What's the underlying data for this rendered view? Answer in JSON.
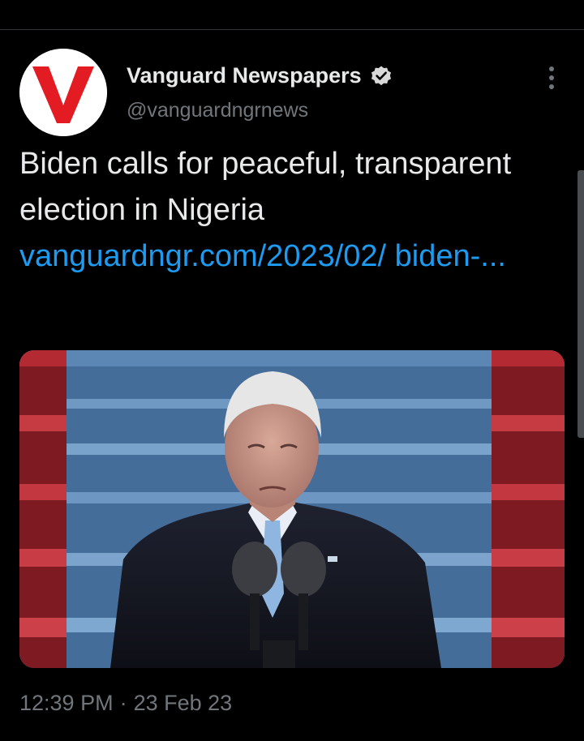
{
  "author": {
    "display_name": "Vanguard Newspapers",
    "handle": "@vanguardngrnews",
    "avatar_letter": "V",
    "avatar_color": "#e31b23",
    "verified": true,
    "verified_icon": "verified-badge-icon"
  },
  "tweet": {
    "text": "Biden calls for peaceful, transparent election in Nigeria",
    "link_text": "vanguardngr.com/2023/02/ biden-...",
    "link_color": "#1d9bf0",
    "media_description_icon": "photo"
  },
  "meta": {
    "time": "12:39 PM",
    "separator": "·",
    "date": "23 Feb 23"
  },
  "menu": {
    "more_icon": "more-vertical-icon"
  }
}
